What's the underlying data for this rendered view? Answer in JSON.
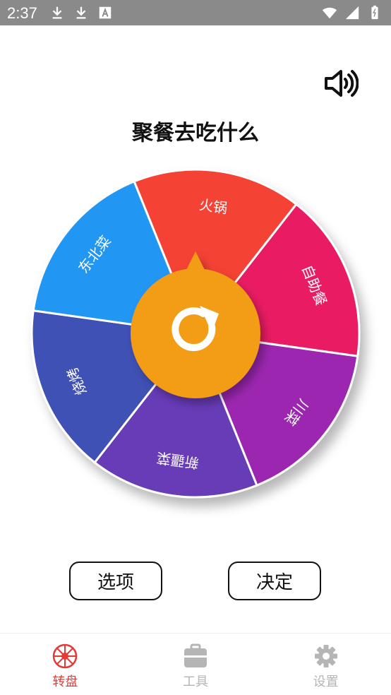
{
  "status_bar": {
    "time": "2:37",
    "icons": [
      "download-icon",
      "download-icon",
      "text-a-icon",
      "wifi-icon",
      "signal-icon",
      "battery-icon"
    ]
  },
  "page": {
    "title": "聚餐去吃什么"
  },
  "wheel": {
    "segments": [
      {
        "label": "火锅",
        "color": "#F44336"
      },
      {
        "label": "自助餐",
        "color": "#E91E63"
      },
      {
        "label": "川菜",
        "color": "#9C27B0"
      },
      {
        "label": "新疆菜",
        "color": "#673AB7"
      },
      {
        "label": "烧烤",
        "color": "#3F51B5"
      },
      {
        "label": "东北菜",
        "color": "#2196F3"
      }
    ],
    "center_color": "#F39C12",
    "center_icon": "refresh-icon"
  },
  "buttons": {
    "options_label": "选项",
    "decide_label": "决定"
  },
  "bottom_nav": {
    "items": [
      {
        "label": "转盘",
        "icon": "wheel-icon",
        "active": true
      },
      {
        "label": "工具",
        "icon": "toolbox-icon",
        "active": false
      },
      {
        "label": "设置",
        "icon": "gear-icon",
        "active": false
      }
    ],
    "active_color": "#E53935",
    "inactive_color": "#B5B5B5"
  }
}
